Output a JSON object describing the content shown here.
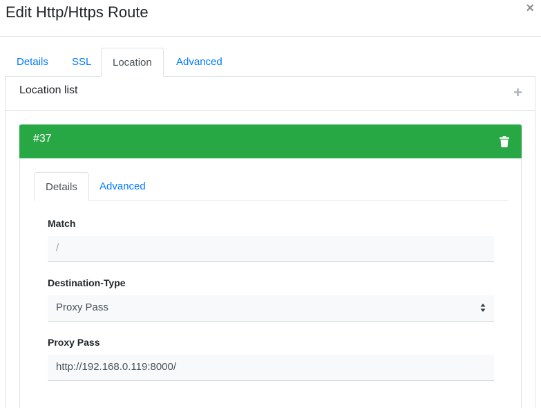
{
  "modal": {
    "title": "Edit Http/Https Route",
    "close_symbol": "×"
  },
  "outer_tabs": [
    {
      "label": "Details",
      "active": false
    },
    {
      "label": "SSL",
      "active": false
    },
    {
      "label": "Location",
      "active": true
    },
    {
      "label": "Advanced",
      "active": false
    }
  ],
  "location_list": {
    "title": "Location list",
    "add_symbol": "+"
  },
  "location": {
    "id_label": "#37",
    "header_color": "#28a745",
    "delete_icon": "trash-icon",
    "tabs": [
      {
        "label": "Details",
        "active": true
      },
      {
        "label": "Advanced",
        "active": false
      }
    ],
    "fields": {
      "match": {
        "label": "Match",
        "placeholder": "/"
      },
      "destination_type": {
        "label": "Destination-Type",
        "value": "Proxy Pass"
      },
      "proxy_pass": {
        "label": "Proxy Pass",
        "value": "http://192.168.0.119:8000/"
      }
    }
  }
}
